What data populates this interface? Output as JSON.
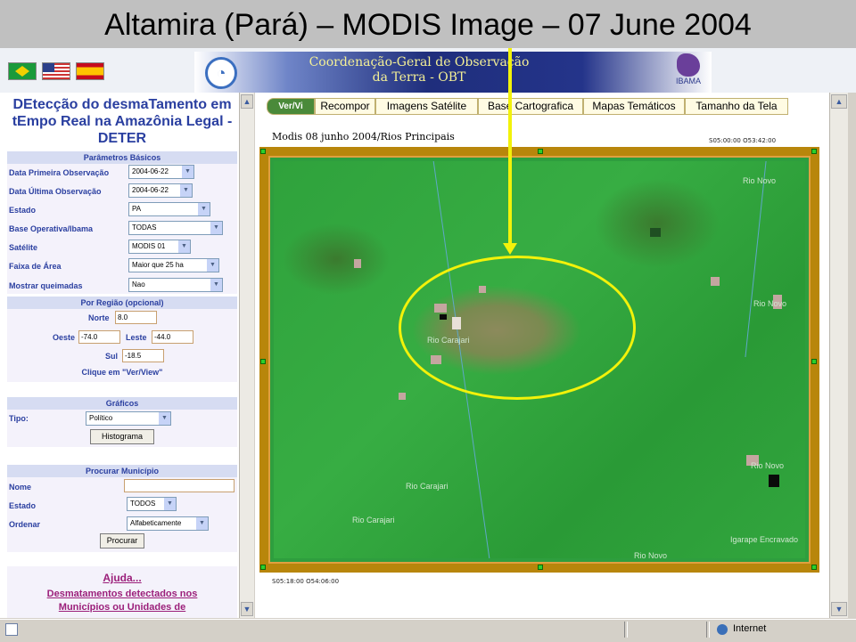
{
  "slide_title": "Altamira (Pará) – MODIS Image – 07 June 2004",
  "header": {
    "flags": [
      "brazil-flag-icon",
      "usa-flag-icon",
      "spain-flag-icon"
    ],
    "banner_line1": "Coordenação-Geral de Observação",
    "banner_line2": "da Terra - OBT",
    "ibama_label": "IBAMA"
  },
  "sidebar": {
    "title": "DEtecção do desmaTamento em tEmpo Real na Amazônia Legal - DETER",
    "basic_params": {
      "heading": "Parâmetros Básicos",
      "fields": [
        {
          "label": "Data Primeira Observação",
          "value": "2004-06-22"
        },
        {
          "label": "Data Última Observação",
          "value": "2004-06-22"
        },
        {
          "label": "Estado",
          "value": "PA"
        },
        {
          "label": "Base Operativa/Ibama",
          "value": "TODAS"
        },
        {
          "label": "Satélite",
          "value": "MODIS 01"
        },
        {
          "label": "Faixa de Área",
          "value": "Maior que 25 ha"
        },
        {
          "label": "Mostrar queimadas",
          "value": "Nao"
        }
      ]
    },
    "region": {
      "heading": "Por Região (opcional)",
      "norte_label": "Norte",
      "norte_value": "8.0",
      "oeste_label": "Oeste",
      "oeste_value": "-74.0",
      "leste_label": "Leste",
      "leste_value": "-44.0",
      "sul_label": "Sul",
      "sul_value": "-18.5",
      "hint": "Clique em \"Ver/View\""
    },
    "graphics": {
      "heading": "Gráficos",
      "tipo_label": "Tipo:",
      "tipo_value": "Político",
      "histogram_button": "Histograma"
    },
    "municipio": {
      "heading": "Procurar Município",
      "nome_label": "Nome",
      "nome_value": "",
      "estado_label": "Estado",
      "estado_value": "TODOS",
      "ordenar_label": "Ordenar",
      "ordenar_value": "Alfabeticamente",
      "search_button": "Procurar"
    },
    "help_link": "Ajuda...",
    "detected_link_line1": "Desmatamentos detectados nos",
    "detected_link_line2": "Municípios ou Unidades de"
  },
  "tabs": [
    "Ver/Vi",
    "Recompor",
    "Imagens Satélite",
    "Base Cartografica",
    "Mapas Temáticos",
    "Tamanho da Tela"
  ],
  "map": {
    "caption": "Modis 08 junho 2004/Rios Principais",
    "coord_top_right": "S05:00:00 O53:42:00",
    "coord_bottom_left": "S05:18:00 O54:06:00",
    "river_labels": [
      "Rio Novo",
      "Rio Novo",
      "Rio Carajari",
      "Rio Carajari",
      "Rio Carajari",
      "Rio Novo",
      "Igarape Encravado",
      "Rio Novo"
    ]
  },
  "status_bar": {
    "zone": "Internet"
  },
  "colors": {
    "sidebar_text": "#2a3fa0",
    "link_color": "#9b1f7a",
    "annotation": "#f2f20a",
    "frame": "#b8860b"
  }
}
